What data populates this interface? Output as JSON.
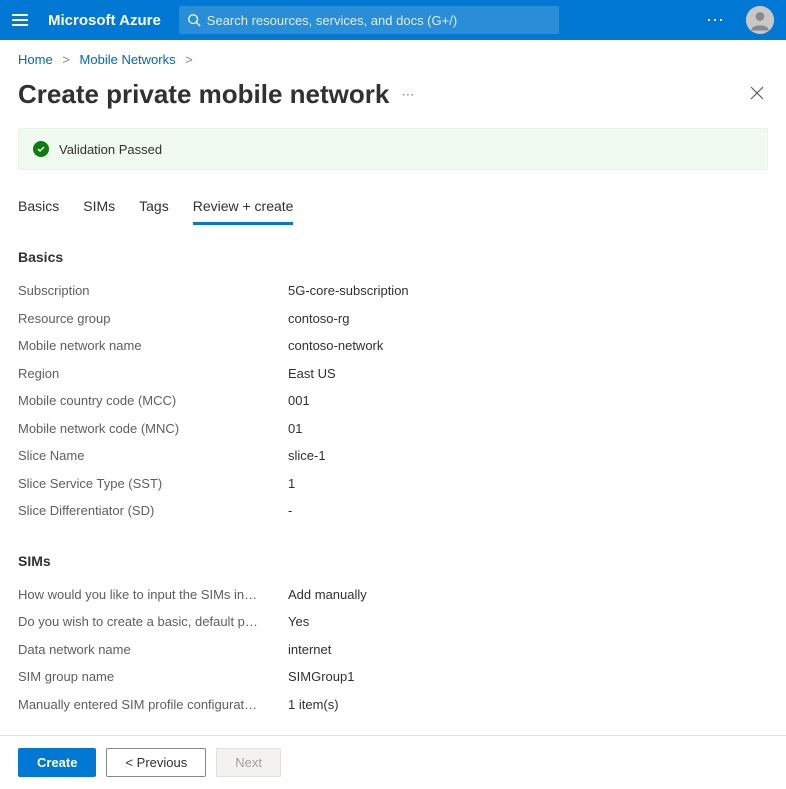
{
  "header": {
    "brand": "Microsoft Azure",
    "search_placeholder": "Search resources, services, and docs (G+/)",
    "more": "⋯"
  },
  "breadcrumb": {
    "home": "Home",
    "section": "Mobile Networks"
  },
  "page": {
    "title": "Create private mobile network",
    "more": "⋯"
  },
  "validation": {
    "message": "Validation Passed"
  },
  "tabs": {
    "basics": "Basics",
    "sims": "SIMs",
    "tags": "Tags",
    "review": "Review + create"
  },
  "sections": {
    "basics": {
      "heading": "Basics",
      "rows": [
        {
          "label": "Subscription",
          "value": "5G-core-subscription"
        },
        {
          "label": "Resource group",
          "value": "contoso-rg"
        },
        {
          "label": "Mobile network name",
          "value": "contoso-network"
        },
        {
          "label": "Region",
          "value": "East US"
        },
        {
          "label": "Mobile country code (MCC)",
          "value": "001"
        },
        {
          "label": "Mobile network code (MNC)",
          "value": "01"
        },
        {
          "label": "Slice Name",
          "value": "slice-1"
        },
        {
          "label": "Slice Service Type (SST)",
          "value": "1"
        },
        {
          "label": "Slice Differentiator (SD)",
          "value": "-"
        }
      ]
    },
    "sims": {
      "heading": "SIMs",
      "rows": [
        {
          "label": "How would you like to input the SIMs in…",
          "value": "Add manually"
        },
        {
          "label": "Do you wish to create a basic, default p…",
          "value": "Yes"
        },
        {
          "label": "Data network name",
          "value": "internet"
        },
        {
          "label": "SIM group name",
          "value": "SIMGroup1"
        },
        {
          "label": "Manually entered SIM profile configurat…",
          "value": "1 item(s)"
        }
      ]
    }
  },
  "footer": {
    "create": "Create",
    "previous": "< Previous",
    "next": "Next"
  }
}
